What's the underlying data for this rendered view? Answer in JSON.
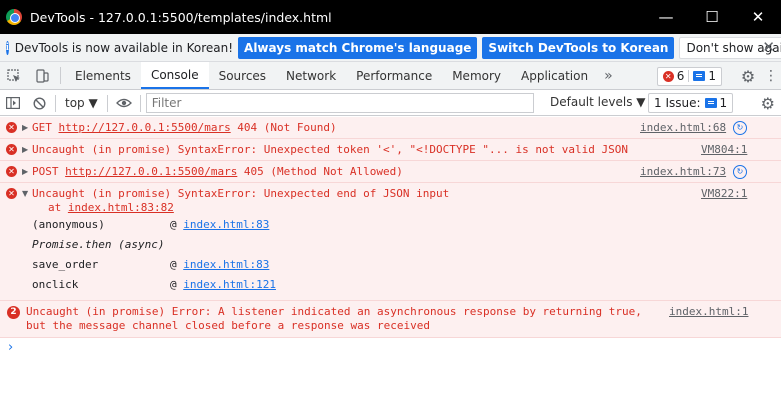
{
  "window": {
    "title": "DevTools - 127.0.0.1:5500/templates/index.html",
    "controls": [
      "—",
      "☐",
      "✕"
    ]
  },
  "infobar": {
    "text": "DevTools is now available in Korean!",
    "btn_match": "Always match Chrome's language",
    "btn_switch": "Switch DevTools to Korean",
    "btn_dismiss": "Don't show again",
    "close": "✕"
  },
  "tabs": {
    "items": [
      "Elements",
      "Console",
      "Sources",
      "Network",
      "Performance",
      "Memory",
      "Application"
    ],
    "active": "Console",
    "more": "»",
    "error_count": "6",
    "message_count": "1"
  },
  "console_toolbar": {
    "context": "top ▼",
    "filter_placeholder": "Filter",
    "levels": "Default levels ▼",
    "issues_label": "1 Issue:",
    "issues_count": "1"
  },
  "messages": [
    {
      "prefix": "GET ",
      "url": "http://127.0.0.1:5500/mars",
      "suffix": " 404 (Not Found)",
      "source": "index.html:68"
    },
    {
      "text": "Uncaught (in promise) SyntaxError: Unexpected token '<', \"<!DOCTYPE \"... is not valid JSON",
      "source": "VM804:1"
    },
    {
      "prefix": "POST ",
      "url": "http://127.0.0.1:5500/mars",
      "suffix": " 405 (Method Not Allowed)",
      "source": "index.html:73"
    },
    {
      "text": "Uncaught (in promise) SyntaxError: Unexpected end of JSON input",
      "at_prefix": "at ",
      "at_link": "index.html:83:82",
      "source": "VM822:1",
      "stack": [
        {
          "fn": "(anonymous)",
          "at": "@ ",
          "link": "index.html:83"
        },
        {
          "fn": "Promise.then (async)"
        },
        {
          "fn": "save_order",
          "at": "@ ",
          "link": "index.html:83"
        },
        {
          "fn": "onclick",
          "at": "@ ",
          "link": "index.html:121"
        }
      ]
    },
    {
      "count": "2",
      "text_line1": "Uncaught (in promise) Error: A listener indicated an asynchronous response by returning true,",
      "text_line2": "but the message channel closed before a response was received",
      "source": "index.html:1"
    }
  ],
  "prompt": "›"
}
